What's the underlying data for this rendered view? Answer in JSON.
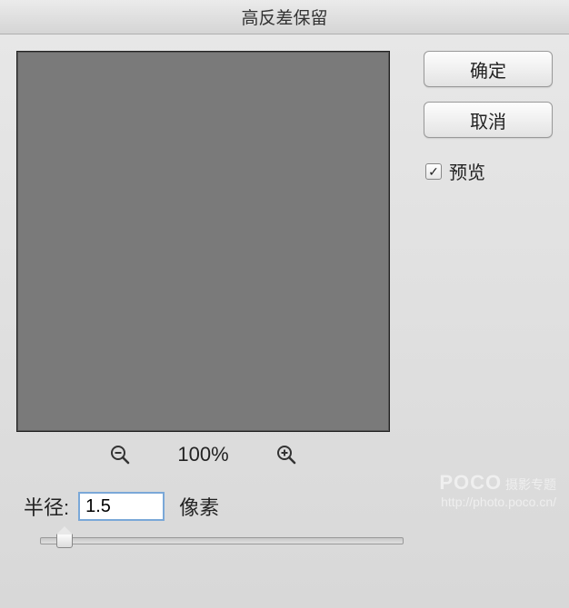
{
  "title": "高反差保留",
  "zoom": {
    "level": "100%"
  },
  "radius": {
    "label": "半径:",
    "value": "1.5",
    "unit": "像素"
  },
  "buttons": {
    "ok": "确定",
    "cancel": "取消"
  },
  "preview_checkbox": {
    "label": "预览",
    "checked": true
  },
  "watermark": {
    "brand": "POCO",
    "tag": "摄影专题",
    "url": "http://photo.poco.cn/"
  }
}
